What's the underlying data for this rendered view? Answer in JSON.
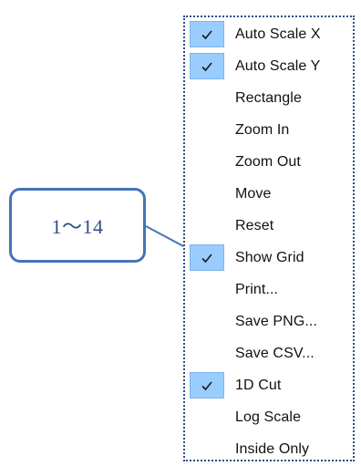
{
  "callout": {
    "label": "1～14"
  },
  "menu": {
    "items": [
      {
        "label": "Auto Scale X",
        "checked": true
      },
      {
        "label": "Auto Scale Y",
        "checked": true
      },
      {
        "label": "Rectangle",
        "checked": false
      },
      {
        "label": "Zoom In",
        "checked": false
      },
      {
        "label": "Zoom Out",
        "checked": false
      },
      {
        "label": "Move",
        "checked": false
      },
      {
        "label": "Reset",
        "checked": false
      },
      {
        "label": "Show Grid",
        "checked": true
      },
      {
        "label": "Print...",
        "checked": false
      },
      {
        "label": "Save PNG...",
        "checked": false
      },
      {
        "label": "Save CSV...",
        "checked": false
      },
      {
        "label": "1D Cut",
        "checked": true
      },
      {
        "label": "Log Scale",
        "checked": false
      },
      {
        "label": "Inside Only",
        "checked": false
      }
    ],
    "check_icon": "checkmark-icon"
  },
  "colors": {
    "check_background": "#99cdff",
    "menu_border": "#2f4c85",
    "callout_border": "#4574b8",
    "callout_text": "#2b4f87"
  }
}
